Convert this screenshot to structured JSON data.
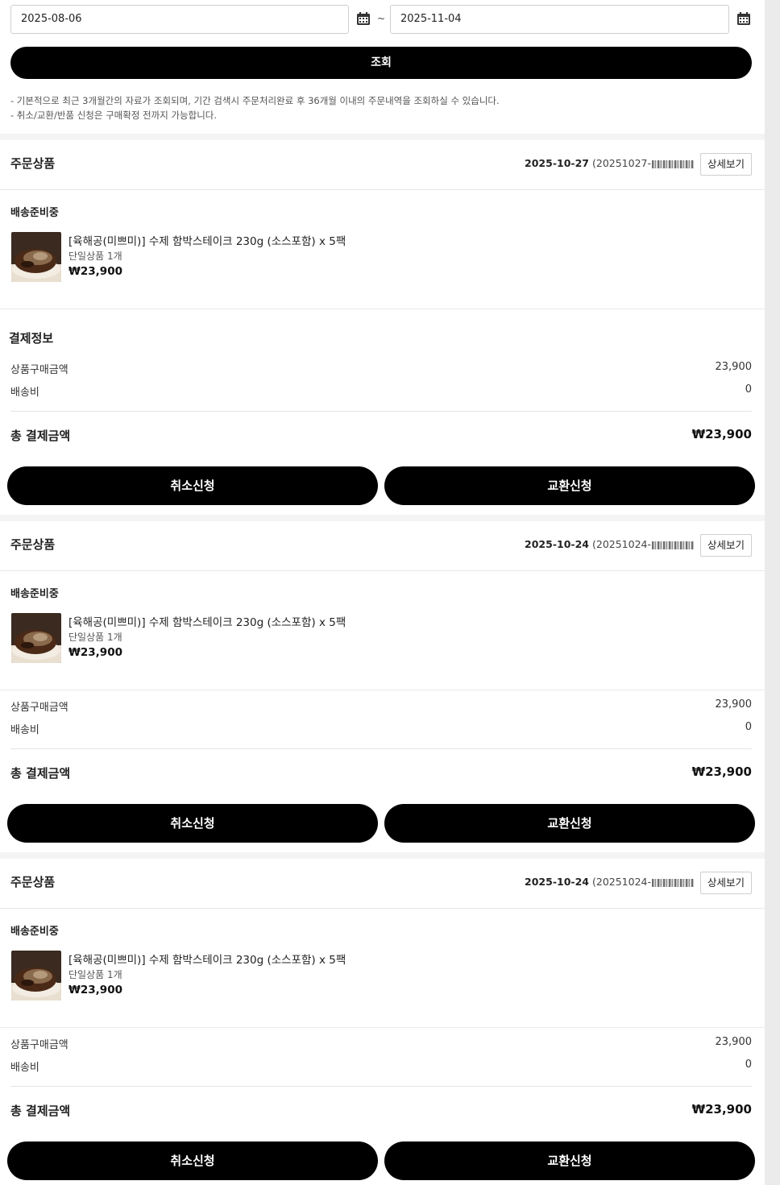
{
  "search": {
    "start_date": "2025-08-06",
    "end_date": "2025-11-04",
    "separator": "~",
    "button_label": "조회",
    "notes": [
      "- 기본적으로 최근 3개월간의 자료가 조회되며, 기간 검색시 주문처리완료 후 36개월 이내의 주문내역을 조회하실 수 있습니다.",
      "- 취소/교환/반품 신청은 구매확정 전까지 가능합니다."
    ]
  },
  "orders": [
    {
      "section_title": "주문상품",
      "date": "2025-10-27",
      "order_no_prefix": "(20251027-",
      "detail_label": "상세보기",
      "status": "배송준비중",
      "product_name": "[육해공(미쁘미)] 수제 함박스테이크 230g (소스포함) x 5팩",
      "product_option": "단일상품 1개",
      "product_price": "₩23,900",
      "payment_title": "결제정보",
      "subtotal_label": "상품구매금액",
      "subtotal_value": "23,900",
      "shipping_label": "배송비",
      "shipping_value": "0",
      "total_label": "총 결제금액",
      "total_value": "₩23,900",
      "cancel_label": "취소신청",
      "exchange_label": "교환신청"
    },
    {
      "section_title": "주문상품",
      "date": "2025-10-24",
      "order_no_prefix": "(20251024-",
      "detail_label": "상세보기",
      "status": "배송준비중",
      "product_name": "[육해공(미쁘미)] 수제 함박스테이크 230g (소스포함) x 5팩",
      "product_option": "단일상품 1개",
      "product_price": "₩23,900",
      "subtotal_label": "상품구매금액",
      "subtotal_value": "23,900",
      "shipping_label": "배송비",
      "shipping_value": "0",
      "total_label": "총 결제금액",
      "total_value": "₩23,900",
      "cancel_label": "취소신청",
      "exchange_label": "교환신청"
    },
    {
      "section_title": "주문상품",
      "date": "2025-10-24",
      "order_no_prefix": "(20251024-",
      "detail_label": "상세보기",
      "status": "배송준비중",
      "product_name": "[육해공(미쁘미)] 수제 함박스테이크 230g (소스포함) x 5팩",
      "product_option": "단일상품 1개",
      "product_price": "₩23,900",
      "subtotal_label": "상품구매금액",
      "subtotal_value": "23,900",
      "shipping_label": "배송비",
      "shipping_value": "0",
      "total_label": "총 결제금액",
      "total_value": "₩23,900",
      "cancel_label": "취소신청",
      "exchange_label": "교환신청"
    }
  ],
  "icons": {
    "calendar": "calendar-icon",
    "thumbnail": "hamburg-steak-thumbnail"
  },
  "colors": {
    "primary_button": "#000000",
    "primary_button_text": "#ffffff",
    "page_background": "#f4f4f4"
  }
}
